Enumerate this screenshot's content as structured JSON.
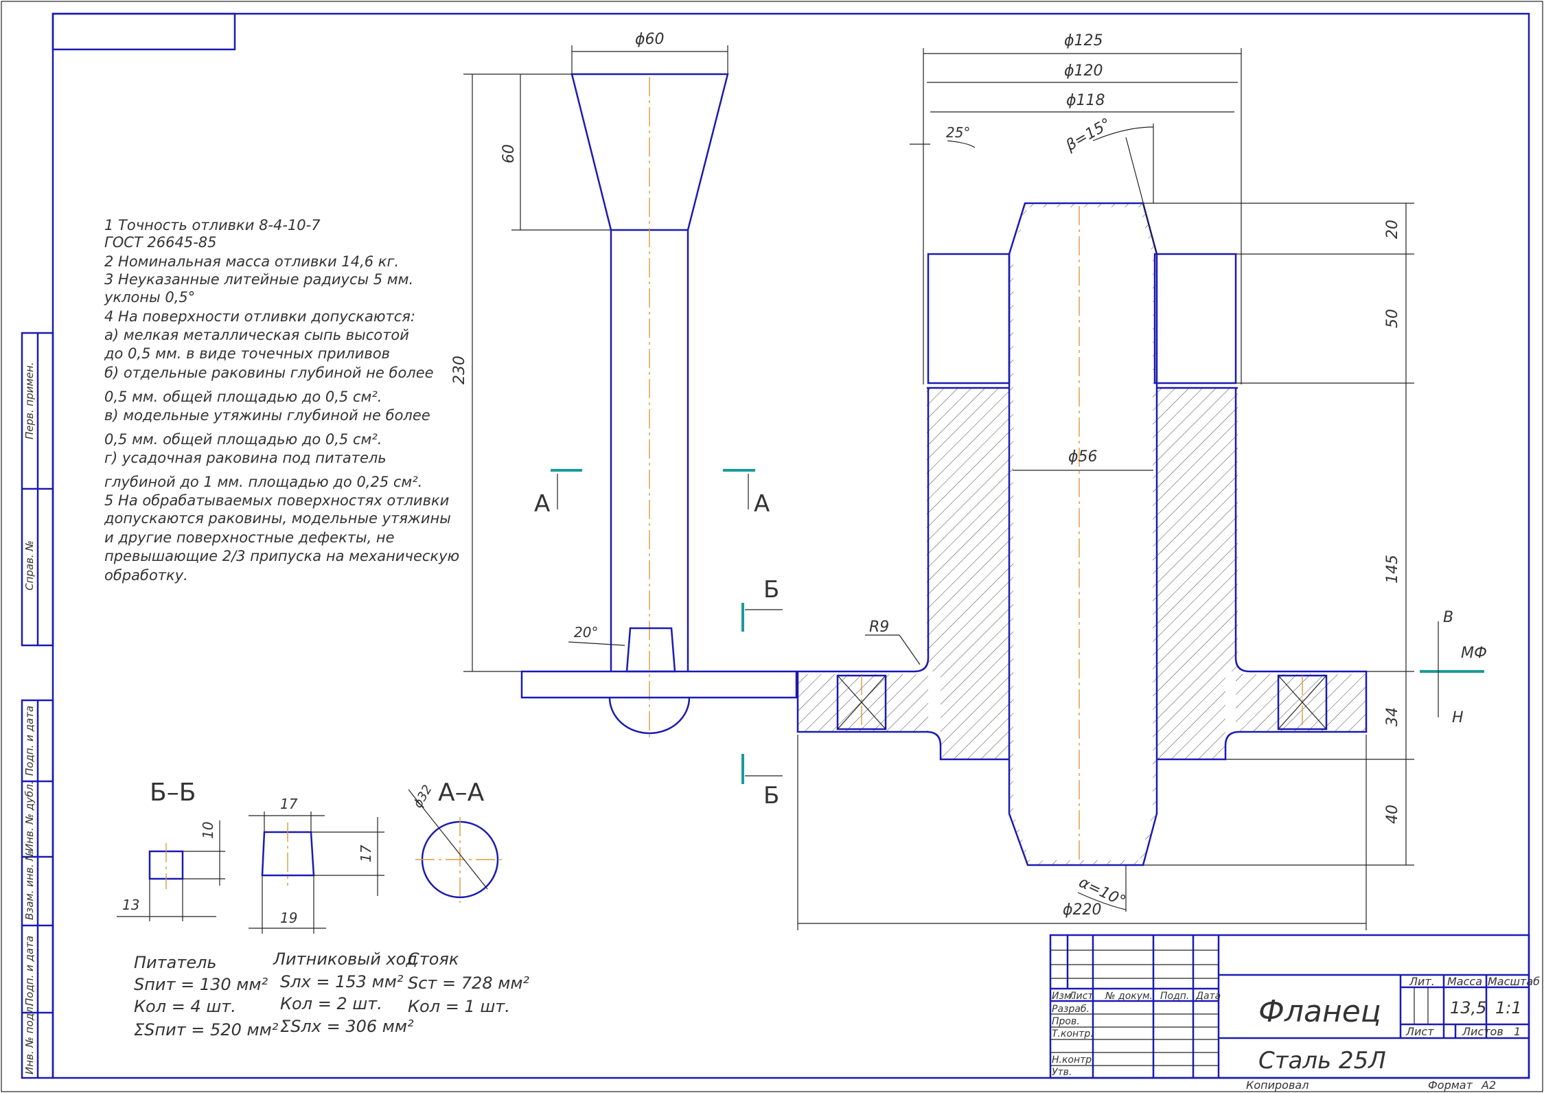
{
  "notes": [
    "1 Точность отливки 8-4-10-7",
    "ГОСТ 26645-85",
    "2 Номинальная масса отливки 14,6 кг.",
    "3 Неуказанные литейные радиусы 5 мм.",
    "уклоны 0,5°",
    "4 На поверхности отливки допускаются:",
    "а) мелкая металлическая сыпь высотой",
    "до 0,5 мм. в виде точечных приливов",
    "б) отдельные раковины глубиной не более",
    "0,5 мм. общей площадью до 0,5 см².",
    "в) модельные утяжины глубиной не более",
    "0,5 мм. общей площадью до 0,5 см².",
    "г) усадочная раковина под питатель",
    "глубиной до 1 мм. площадью до 0,25 см².",
    "5 На обрабатываемых поверхностях отливки",
    "допускаются раковины, модельные утяжины",
    "и другие поверхностные дефекты, не",
    "превышающие 2/3 припуска на механическую",
    "обработку."
  ],
  "dims": {
    "d60": "ϕ60",
    "h60": "60",
    "h230": "230",
    "a20": "20°",
    "d125": "ϕ125",
    "d120": "ϕ120",
    "d118": "ϕ118",
    "a25": "25°",
    "beta": "β=15°",
    "d56": "ϕ56",
    "r9": "R9",
    "alpha": "α=10°",
    "d220": "ϕ220",
    "v20": "20",
    "v50": "50",
    "v145": "145",
    "v34": "34",
    "v40": "40"
  },
  "cuts": {
    "a_left": "А",
    "a_right": "А",
    "b_top": "Б",
    "b_bot": "Б",
    "v": "В",
    "mf": "МФ",
    "n": "Н"
  },
  "sections": {
    "bb_title": "Б–Б",
    "aa_title": "А–А",
    "bb_w": "13",
    "bb_h": "10",
    "tr_top": "17",
    "tr_bot": "19",
    "tr_h": "17",
    "circle_d": "ϕ32"
  },
  "summary": {
    "pit_title": "Питатель",
    "pit_area": "Sпит = 130 мм²",
    "pit_count": "Кол = 4 шт.",
    "pit_total": "ΣSпит = 520 мм²",
    "lh_title": "Литниковый ход",
    "lh_area": "Sлх = 153 мм²",
    "lh_count": "Кол = 2 шт.",
    "lh_total": "ΣSлх = 306 мм²",
    "st_title": "Стояк",
    "st_area": "Sст = 728 мм²",
    "st_count": "Кол = 1 шт."
  },
  "side_labels": [
    "Перв. примен.",
    "Справ. №",
    "Подп. и дата",
    "Инв. № дубл.",
    "Взам. инв. №",
    "Подп. и дата",
    "Инв. № подл."
  ],
  "title_block": {
    "name": "Фланец",
    "material": "Сталь 25Л",
    "cols": [
      "Изм.",
      "Лист",
      "№ докум.",
      "Подп.",
      "Дата"
    ],
    "rows": [
      "Разраб.",
      "Пров.",
      "Т.контр.",
      "Н.контр.",
      "Утв."
    ],
    "lit": "Лит.",
    "massa": "Масса",
    "masshtab": "Масштаб",
    "mass_val": "13,5",
    "scale_val": "1:1",
    "list": "Лист",
    "listov": "Листов",
    "listov_val": "1",
    "kopiroval": "Копировал",
    "format": "Формат",
    "format_val": "А2"
  }
}
